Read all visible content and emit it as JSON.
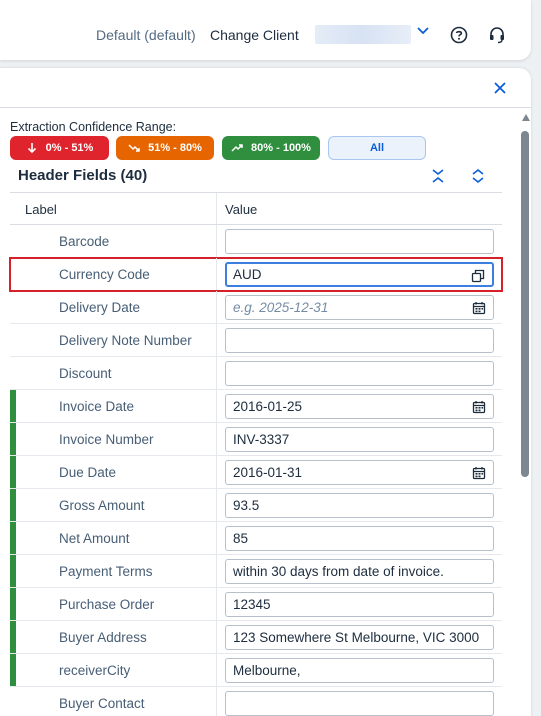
{
  "shellbar": {
    "client_label": "Default (default)",
    "change_client_label": "Change Client"
  },
  "extraction": {
    "label": "Extraction Confidence Range:",
    "chips": [
      {
        "label": "0% - 51%",
        "color": "#e0242e"
      },
      {
        "label": "51% - 80%",
        "color": "#e76500"
      },
      {
        "label": "80% - 100%",
        "color": "#2f8f3f"
      },
      {
        "label": "All"
      }
    ]
  },
  "header_fields": {
    "title": "Header Fields (40)",
    "columns": {
      "label": "Label",
      "value": "Value"
    },
    "rows": [
      {
        "label": "Barcode",
        "value": "",
        "placeholder": "",
        "icon": "",
        "confidence": ""
      },
      {
        "label": "Currency Code",
        "value": "AUD",
        "placeholder": "",
        "icon": "value-help-icon",
        "confidence": ""
      },
      {
        "label": "Delivery Date",
        "value": "",
        "placeholder": "e.g. 2025-12-31",
        "icon": "calendar-icon",
        "confidence": ""
      },
      {
        "label": "Delivery Note Number",
        "value": "",
        "placeholder": "",
        "icon": "",
        "confidence": ""
      },
      {
        "label": "Discount",
        "value": "",
        "placeholder": "",
        "icon": "",
        "confidence": ""
      },
      {
        "label": "Invoice Date",
        "value": "2016-01-25",
        "placeholder": "",
        "icon": "calendar-icon",
        "confidence": "#2f8f3f"
      },
      {
        "label": "Invoice Number",
        "value": "INV-3337",
        "placeholder": "",
        "icon": "",
        "confidence": "#2f8f3f"
      },
      {
        "label": "Due Date",
        "value": "2016-01-31",
        "placeholder": "",
        "icon": "calendar-icon",
        "confidence": "#2f8f3f"
      },
      {
        "label": "Gross Amount",
        "value": "93.5",
        "placeholder": "",
        "icon": "",
        "confidence": "#2f8f3f"
      },
      {
        "label": "Net Amount",
        "value": "85",
        "placeholder": "",
        "icon": "",
        "confidence": "#2f8f3f"
      },
      {
        "label": "Payment Terms",
        "value": "within 30 days from date of invoice.",
        "placeholder": "",
        "icon": "",
        "confidence": "#2f8f3f"
      },
      {
        "label": "Purchase Order",
        "value": "12345",
        "placeholder": "",
        "icon": "",
        "confidence": "#2f8f3f"
      },
      {
        "label": "Buyer Address",
        "value": "123 Somewhere St Melbourne, VIC 3000",
        "placeholder": "",
        "icon": "",
        "confidence": "#2f8f3f"
      },
      {
        "label": "receiverCity",
        "value": "Melbourne,",
        "placeholder": "",
        "icon": "",
        "confidence": "#2f8f3f"
      },
      {
        "label": "Buyer Contact",
        "value": "",
        "placeholder": "",
        "icon": "",
        "confidence": ""
      }
    ]
  }
}
